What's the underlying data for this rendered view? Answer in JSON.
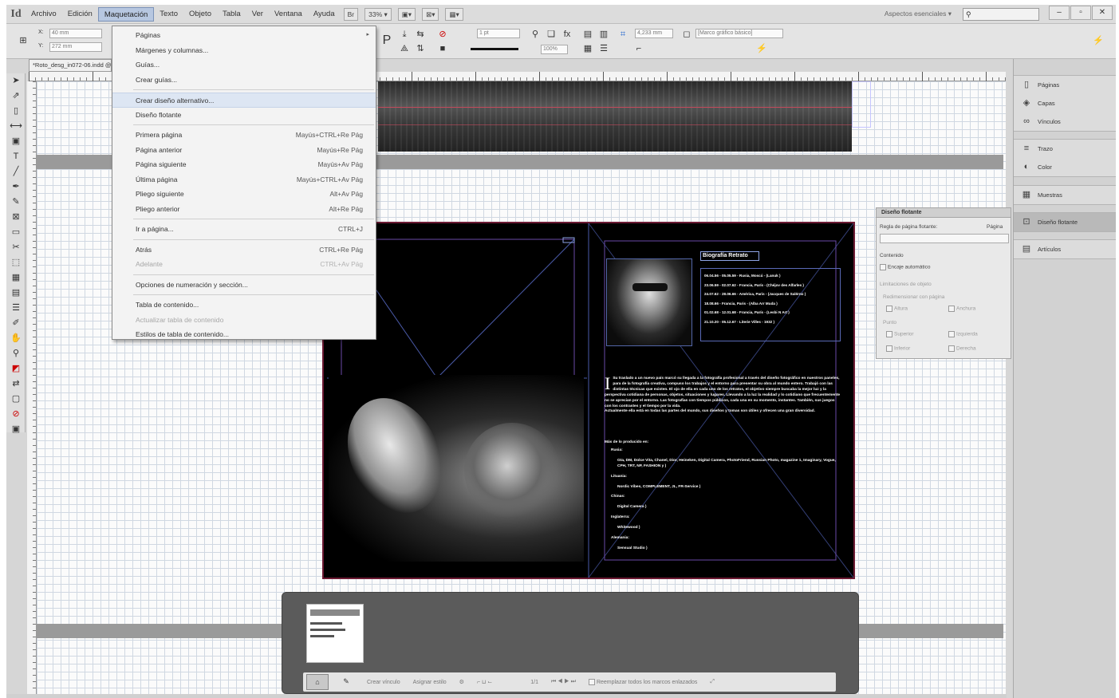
{
  "app": {
    "logo": "Id"
  },
  "menubar": {
    "items": [
      "Archivo",
      "Edición",
      "Maquetación",
      "Texto",
      "Objeto",
      "Tabla",
      "Ver",
      "Ventana",
      "Ayuda"
    ],
    "active": "Maquetación",
    "bridge_label": "Br",
    "zoom": "33%",
    "workspace": "Aspectos esenciales",
    "search_placeholder": "",
    "window_controls": [
      "–",
      "▫",
      "✕"
    ]
  },
  "controlbar": {
    "x_label": "X:",
    "y_label": "Y:",
    "x_value": "40 mm",
    "y_value": "272 mm",
    "stroke_weight": "1 pt",
    "scale": "100%",
    "dimension": "4,233 mm",
    "style_name": "[Marco gráfico básico]"
  },
  "document": {
    "tab_title": "*Roto_desg_in072-06.indd @ 33%"
  },
  "dropdown": {
    "items": [
      {
        "label": "Páginas",
        "shortcut": "",
        "submenu": true,
        "disabled": false
      },
      {
        "label": "Márgenes y columnas...",
        "shortcut": "",
        "disabled": false
      },
      {
        "label": "Guías...",
        "shortcut": "",
        "disabled": false
      },
      {
        "label": "Crear guías...",
        "shortcut": "",
        "disabled": false
      },
      {
        "sep": true
      },
      {
        "label": "Crear diseño alternativo...",
        "shortcut": "",
        "disabled": false,
        "highlight": true
      },
      {
        "label": "Diseño flotante",
        "shortcut": "",
        "disabled": false
      },
      {
        "sep": true
      },
      {
        "label": "Primera página",
        "shortcut": "Mayús+CTRL+Re Pág",
        "disabled": false
      },
      {
        "label": "Página anterior",
        "shortcut": "Mayús+Re Pág",
        "disabled": false
      },
      {
        "label": "Página siguiente",
        "shortcut": "Mayús+Av Pág",
        "disabled": false
      },
      {
        "label": "Última página",
        "shortcut": "Mayús+CTRL+Av Pág",
        "disabled": false
      },
      {
        "label": "Pliego siguiente",
        "shortcut": "Alt+Av Pág",
        "disabled": false
      },
      {
        "label": "Pliego anterior",
        "shortcut": "Alt+Re Pág",
        "disabled": false
      },
      {
        "sep": true
      },
      {
        "label": "Ir a página...",
        "shortcut": "CTRL+J",
        "disabled": false
      },
      {
        "sep": true
      },
      {
        "label": "Atrás",
        "shortcut": "CTRL+Re Pág",
        "disabled": false
      },
      {
        "label": "Adelante",
        "shortcut": "CTRL+Av Pág",
        "disabled": true
      },
      {
        "sep": true
      },
      {
        "label": "Opciones de numeración y sección...",
        "shortcut": "",
        "disabled": false
      },
      {
        "sep": true
      },
      {
        "label": "Tabla de contenido...",
        "shortcut": "",
        "disabled": false
      },
      {
        "label": "Actualizar tabla de contenido",
        "shortcut": "",
        "disabled": true
      },
      {
        "label": "Estilos de tabla de contenido...",
        "shortcut": "",
        "disabled": false
      }
    ]
  },
  "spread": {
    "bio_title": "Biografía Retrato",
    "timeline": [
      "06.04.56 - 05.05.59 - Rusia, Moscú - (Lanuk )",
      "23.06.59 - 02.07.62 - Francia, París - (Chéjov des Alfarles )",
      "24.07.62 - 28.06.66 - América, Paris - (Jacques de Salérno )",
      "18.08.66 - Francia, Paris - (Alba Arr Muda )",
      "01.02.68 - 12.01.68 - Francia, París - (Lesbi N Art )",
      "21.10.20 - 05.12.67 - Literie Villes - 1932 )"
    ],
    "bio_cap": "I",
    "bio_text": "Su traslado a un nuevo país marcó su llegada a la fotografía profesional a través del diseño fotográfico en nuestros paneles, para de la fotografía creativa, compuso los trabajos y el entorno para presentar su obra al mundo entero. Trabajó con las distintas técnicas que existen. El ojo de ella en cada uno de los retratos, el objetivo siempre buscaba la mejor luz y la perspectiva cotidiana de personas, objetos, situaciones y lugares. Llevando a la luz la realidad y lo cotidiano que frecuentemente no se aprecian por el entorno. Las fotografías con tiempos públicos, cada una en su momento, instantes. También, sus juegos con los contrastes y el tiempo por la vida.",
    "bio_text2": "Actualmente ella está en todas las partes del mundo, sus diseños y tomas son útiles y ofrecen una gran diversidad.",
    "list_title": "Más de lo producido en:",
    "list": [
      {
        "h": "Rusia:",
        "d": "Gta, DM, Dolce Vita, Chanel, Dior, Heineken, Digital Camera, PhotoFriend, Russian Photo, magazine 1, Imaginary, Vogue, CPH, TRT, NP, FASHION y )"
      },
      {
        "h": "Lituania:",
        "d": "Nordic Vibes, COMPLEMENT, JL, FR-Service )"
      },
      {
        "h": "Chinas:",
        "d": "Digital Camera )"
      },
      {
        "h": "Inglaterra:",
        "d": "Whitewood )"
      },
      {
        "h": "Alemania:",
        "d": "Sensual Studio )"
      }
    ]
  },
  "liquid_panel": {
    "title": "Diseño flotante",
    "rule_label": "Regla de página flotante:",
    "page_label": "Página",
    "content_label": "Contenido",
    "auto_fit": "Encaje automático",
    "constraints_label": "Limitaciones de objeto",
    "resize_label": "Redimensionar con página",
    "height": "Altura",
    "width": "Anchura",
    "pin_label": "Punto",
    "top": "Superior",
    "left": "Izquierda",
    "bottom": "Inferior",
    "right": "Derecha"
  },
  "dock": {
    "group1": [
      {
        "label": "Páginas",
        "icon": "pages-icon"
      },
      {
        "label": "Capas",
        "icon": "layers-icon"
      },
      {
        "label": "Vínculos",
        "icon": "links-icon"
      }
    ],
    "group2": [
      {
        "label": "Trazo",
        "icon": "stroke-icon"
      },
      {
        "label": "Color",
        "icon": "color-icon"
      }
    ],
    "group3": [
      {
        "label": "Muestras",
        "icon": "swatches-icon"
      }
    ],
    "group4": [
      {
        "label": "Diseño flotante",
        "icon": "liquid-layout-icon",
        "active": true
      }
    ],
    "group5": [
      {
        "label": "Artículos",
        "icon": "articles-icon"
      }
    ]
  },
  "pages_panel": {
    "create_link": "Crear vínculo",
    "assign_master": "Asignar estilo",
    "page_count": "1/1",
    "relink": "Reemplazar todos los marcos enlazados"
  }
}
